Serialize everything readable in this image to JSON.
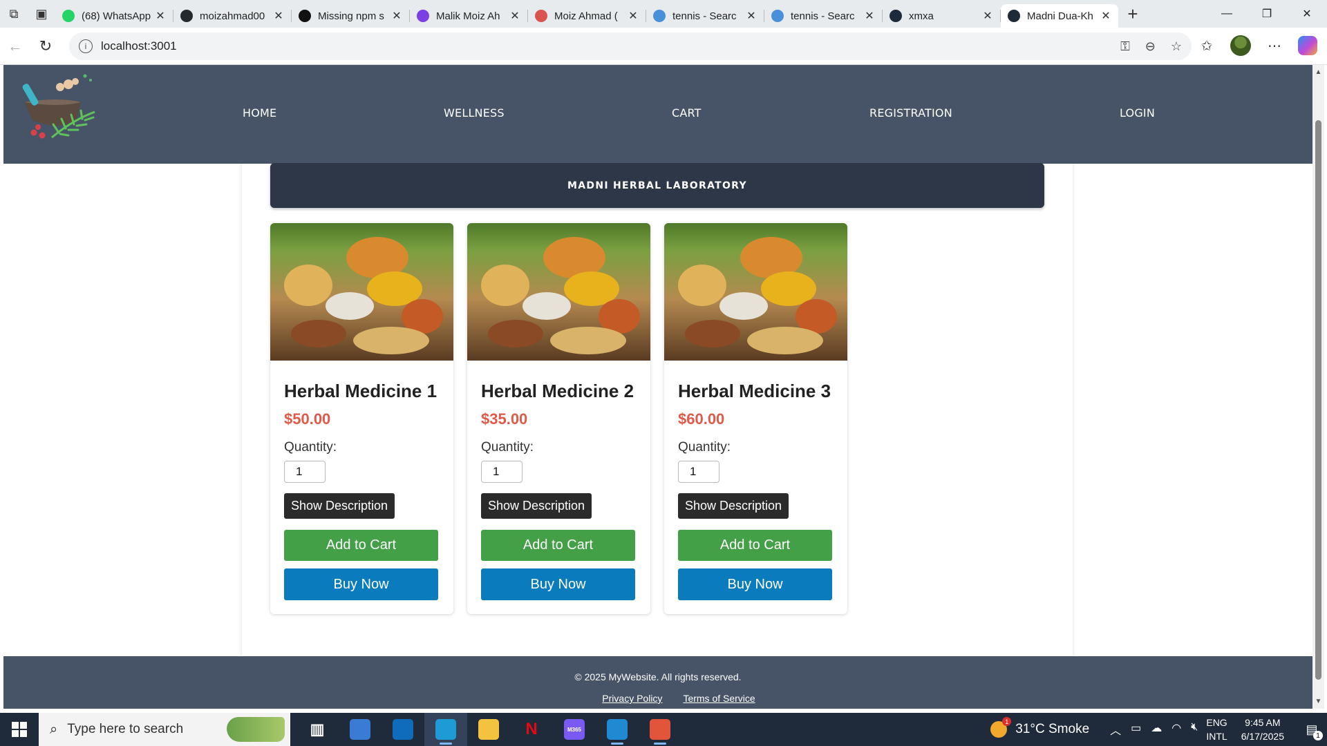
{
  "browser": {
    "tabs": [
      {
        "title": "(68) WhatsApp",
        "favicon": "whatsapp-icon",
        "color": "#25d366"
      },
      {
        "title": "moizahmad00",
        "favicon": "github-icon",
        "color": "#24292e"
      },
      {
        "title": "Missing npm s",
        "favicon": "openai-icon",
        "color": "#111111"
      },
      {
        "title": "Malik Moiz Ah",
        "favicon": "vercel-v-icon",
        "color": "#7b3fe4"
      },
      {
        "title": "Moiz Ahmad (",
        "favicon": "pdf-icon",
        "color": "#d9534f"
      },
      {
        "title": "tennis - Searc",
        "favicon": "search-icon",
        "color": "#4a90d9"
      },
      {
        "title": "tennis - Searc",
        "favicon": "search-icon",
        "color": "#4a90d9"
      },
      {
        "title": "xmxa",
        "favicon": "react-icon",
        "color": "#1e2a38"
      },
      {
        "title": "Madni Dua-Kh",
        "favicon": "react-icon",
        "color": "#1e2a38"
      }
    ],
    "url": "localhost:3001"
  },
  "site": {
    "nav": [
      "HOME",
      "WELLNESS",
      "CART",
      "REGISTRATION",
      "LOGIN"
    ],
    "banner": "MADNI HERBAL LABORATORY",
    "products": [
      {
        "name": "Herbal Medicine 1",
        "price": "$50.00",
        "quantity_label": "Quantity:",
        "quantity": "1",
        "description_label": "Show Description",
        "cart_label": "Add to Cart",
        "buy_label": "Buy Now"
      },
      {
        "name": "Herbal Medicine 2",
        "price": "$35.00",
        "quantity_label": "Quantity:",
        "quantity": "1",
        "description_label": "Show Description",
        "cart_label": "Add to Cart",
        "buy_label": "Buy Now"
      },
      {
        "name": "Herbal Medicine 3",
        "price": "$60.00",
        "quantity_label": "Quantity:",
        "quantity": "1",
        "description_label": "Show Description",
        "cart_label": "Add to Cart",
        "buy_label": "Buy Now"
      }
    ],
    "footer": {
      "copyright": "© 2025 MyWebsite. All rights reserved.",
      "links": [
        "Privacy Policy",
        "Terms of Service"
      ]
    },
    "colors": {
      "header": "#475467",
      "banner": "#2d3748",
      "price": "#e05a4a",
      "add_to_cart": "#43a047",
      "buy_now": "#0a7bbd"
    }
  },
  "taskbar": {
    "search_placeholder": "Type here to search",
    "apps": [
      {
        "name": "task-view-icon",
        "label": ""
      },
      {
        "name": "microsoft-store-icon",
        "label": ""
      },
      {
        "name": "outlook-icon",
        "label": ""
      },
      {
        "name": "edge-icon",
        "label": ""
      },
      {
        "name": "file-explorer-icon",
        "label": ""
      },
      {
        "name": "netflix-icon",
        "label": "N"
      },
      {
        "name": "m365-icon",
        "label": "M365"
      },
      {
        "name": "vscode-icon",
        "label": ""
      },
      {
        "name": "snipping-tool-icon",
        "label": ""
      }
    ],
    "weather": "31°C  Smoke",
    "weather_badge": "1",
    "lang_line1": "ENG",
    "lang_line2": "INTL",
    "time": "9:45 AM",
    "date": "6/17/2025",
    "notification_count": "1"
  }
}
